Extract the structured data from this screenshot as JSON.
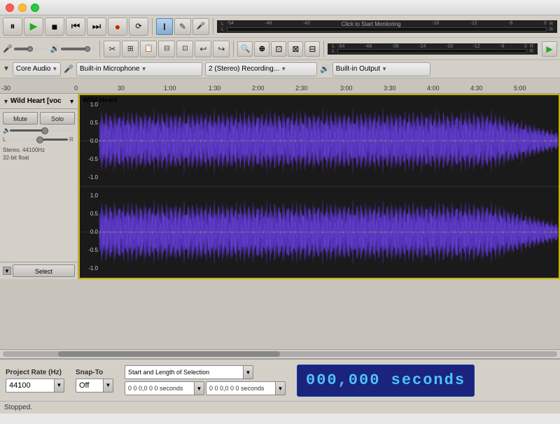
{
  "titlebar": {
    "buttons": [
      "close",
      "minimize",
      "maximize"
    ]
  },
  "transport": {
    "pause_label": "⏸",
    "play_label": "▶",
    "stop_label": "■",
    "prev_label": "⏮",
    "next_label": "⏭",
    "record_label": "●",
    "loop_label": "⟳"
  },
  "tools": {
    "select_label": "I",
    "pencil_label": "✏",
    "mic_label": "🎤",
    "zoom_label": "🔍",
    "scissors_label": "✂",
    "copy_label": "⊞",
    "silence_label": "⊟",
    "envelope_label": "⌒",
    "multi_label": "⊕",
    "undo_label": "↩",
    "redo_label": "↪",
    "zoom_in_label": "⊕",
    "zoom_out_label": "⊖",
    "zoom_fit_label": "⊡",
    "zoom_sel_label": "⊠",
    "play_at_label": "▶"
  },
  "monitor": {
    "click_label": "Click to Start Monitoring",
    "scale": [
      "-54",
      "-48",
      "-42",
      "-18",
      "-12",
      "-6",
      "0"
    ],
    "scale2": [
      "-54",
      "-48",
      "-36",
      "-24",
      "-18",
      "-12",
      "-6",
      "0"
    ]
  },
  "devices": {
    "audio_host": "Core Audio",
    "input_device": "Built-in Microphone",
    "recording_mode": "2 (Stereo) Recording...",
    "output_device": "Built-in Output"
  },
  "ruler": {
    "ticks": [
      "-30",
      "0",
      "30",
      "1:00",
      "1:30",
      "2:00",
      "2:30",
      "3:00",
      "3:30",
      "4:00",
      "4:30",
      "5:00"
    ]
  },
  "track": {
    "name": "Wild Heart [voc",
    "title_display": "Wild Heart",
    "mute_label": "Mute",
    "solo_label": "Solo",
    "info": "Stereo, 44100Hz\n32-bit float",
    "select_label": "Select"
  },
  "bottom": {
    "project_rate_label": "Project Rate (Hz)",
    "project_rate_value": "44100",
    "snap_to_label": "Snap-To",
    "snap_off_label": "Off",
    "selection_label": "Start and Length of Selection",
    "sel_start": "0 0 0,0 0 0 seconds",
    "sel_end": "0 0 0,0 0 0 seconds",
    "big_time": "000,000 seconds"
  },
  "status": {
    "text": "Stopped."
  }
}
